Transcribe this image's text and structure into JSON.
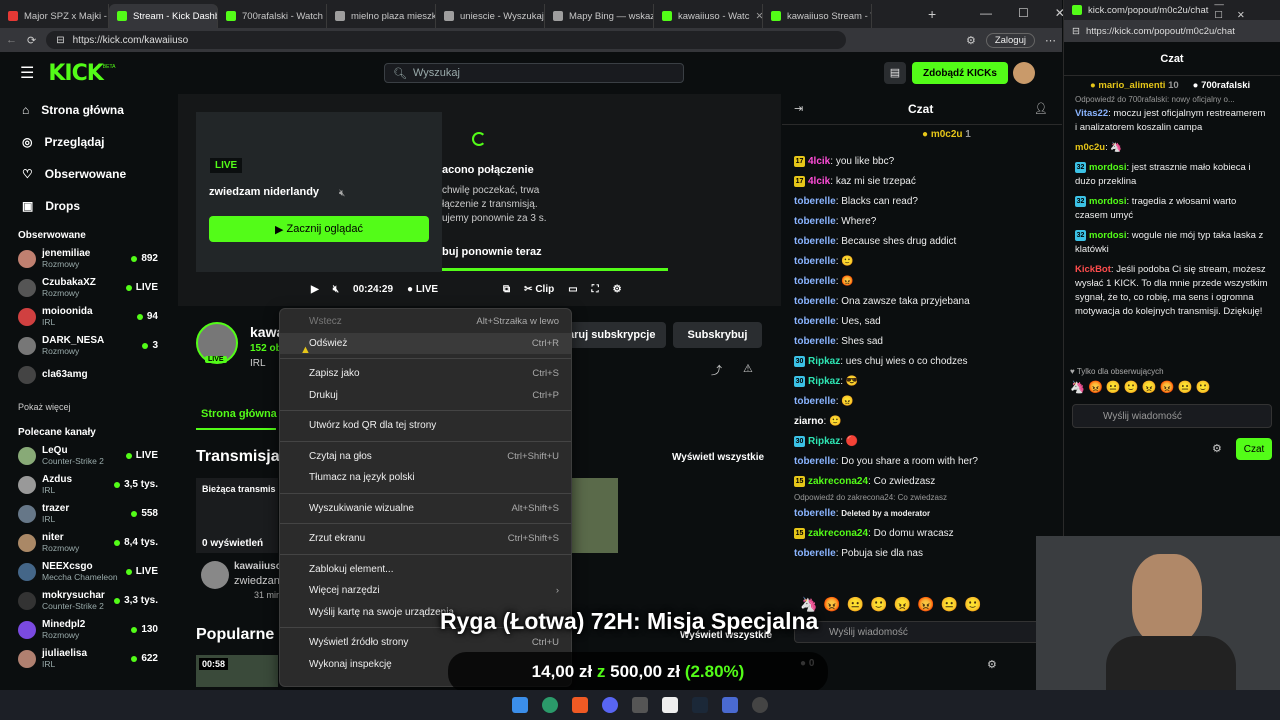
{
  "browser": {
    "tabs": [
      {
        "label": "Major SPZ x Majki -",
        "color": "#e53935"
      },
      {
        "label": "Stream - Kick Dashb",
        "color": "#53fc18",
        "active": true
      },
      {
        "label": "700rafalski - Watch",
        "color": "#53fc18"
      },
      {
        "label": "mielno plaza mieszk",
        "color": "#9e9e9e"
      },
      {
        "label": "uniescie - Wyszukaj",
        "color": "#9e9e9e"
      },
      {
        "label": "Mapy Bing — wskaz",
        "color": "#9e9e9e"
      },
      {
        "label": "kawaiiuso - Watc",
        "color": "#53fc18"
      },
      {
        "label": "kawaiiuso Stream - V",
        "color": "#53fc18"
      }
    ],
    "url": "https://kick.com/kawaiiuso",
    "login": "Zaloguj"
  },
  "header": {
    "logo": "KICK",
    "logo_sup": "BETA",
    "search_placeholder": "Wyszukaj",
    "kicks_button": "Zdobądź KICKs"
  },
  "sidebar": {
    "nav": [
      {
        "label": "Strona główna",
        "icon": "home-icon"
      },
      {
        "label": "Przeglądaj",
        "icon": "compass-icon"
      },
      {
        "label": "Obserwowane",
        "icon": "heart-icon"
      },
      {
        "label": "Drops",
        "icon": "gift-icon"
      }
    ],
    "followed_title": "Obserwowane",
    "followed": [
      {
        "name": "jenemiliae",
        "cat": "Rozmowy",
        "count": "892",
        "color": "#c08070"
      },
      {
        "name": "CzubakaXZ",
        "cat": "Rozmowy",
        "count": "LIVE",
        "color": "#555"
      },
      {
        "name": "moioonida",
        "cat": "IRL",
        "count": "94",
        "color": "#d04040"
      },
      {
        "name": "DARK_NESA",
        "cat": "Rozmowy",
        "count": "3",
        "color": "#777"
      },
      {
        "name": "cla63amg",
        "cat": "",
        "count": "",
        "color": "#444"
      }
    ],
    "show_more": "Pokaż więcej",
    "recommended_title": "Polecane kanały",
    "recommended": [
      {
        "name": "LeQu",
        "cat": "Counter-Strike 2",
        "count": "LIVE",
        "color": "#8a7"
      },
      {
        "name": "Azdus",
        "cat": "IRL",
        "count": "3,5 tys.",
        "color": "#999"
      },
      {
        "name": "trazer",
        "cat": "IRL",
        "count": "558",
        "color": "#678"
      },
      {
        "name": "niter",
        "cat": "Rozmowy",
        "count": "8,4 tys.",
        "color": "#a86"
      },
      {
        "name": "NEEXcsgo",
        "cat": "Meccha Chameleon",
        "count": "LIVE",
        "color": "#468"
      },
      {
        "name": "mokrysuchar",
        "cat": "Counter-Strike 2",
        "count": "3,3 tys.",
        "color": "#333"
      },
      {
        "name": "Minedpl2",
        "cat": "Rozmowy",
        "count": "130",
        "color": "#7a4ae0"
      },
      {
        "name": "jiuliaelisa",
        "cat": "IRL",
        "count": "622",
        "color": "#b08070"
      }
    ]
  },
  "player": {
    "live": "LIVE",
    "title": "zwiedzam niderlandy",
    "watch": "Zacznij oglądać",
    "error_title": "acono połączenie",
    "error_text": "chwilę poczekać, trwa\nłączenie z transmisją.\nujemy ponownie za 3 s.",
    "retry": "buj ponownie teraz",
    "time": "00:24:29",
    "live_ctrl": "LIVE",
    "clip": "Clip"
  },
  "channel": {
    "name": "kawa",
    "followers": "152 ob",
    "tag": "IRL",
    "subscribe_gift": "aruj subskrypcje",
    "subscribe": "Subskrybuj",
    "tab_home": "Strona główna",
    "streams_heading": "Transmisja",
    "view_all": "Wyświetl wszystkie",
    "current": "Bieżąca transmis",
    "views": "0 wyświetleń",
    "vid_channel": "kawaiiuso",
    "vid_title": "zwiedzan",
    "vid_time": "31 min",
    "popular": "Popularne",
    "popular_view_all": "Wyświetl wszystkie",
    "dur": "00:58"
  },
  "context_menu": [
    {
      "label": "Wstecz",
      "shortcut": "Alt+Strzałka w lewo",
      "disabled": true
    },
    {
      "label": "Odśwież",
      "shortcut": "Ctrl+R",
      "hover": true
    },
    {
      "sep": true
    },
    {
      "label": "Zapisz jako",
      "shortcut": "Ctrl+S"
    },
    {
      "label": "Drukuj",
      "shortcut": "Ctrl+P"
    },
    {
      "sep": true
    },
    {
      "label": "Utwórz kod QR dla tej strony",
      "shortcut": ""
    },
    {
      "sep": true
    },
    {
      "label": "Czytaj na głos",
      "shortcut": "Ctrl+Shift+U"
    },
    {
      "label": "Tłumacz na język polski",
      "shortcut": ""
    },
    {
      "sep": true
    },
    {
      "label": "Wyszukiwanie wizualne",
      "shortcut": "Alt+Shift+S"
    },
    {
      "sep": true
    },
    {
      "label": "Zrzut ekranu",
      "shortcut": "Ctrl+Shift+S"
    },
    {
      "sep": true
    },
    {
      "label": "Zablokuj element...",
      "shortcut": ""
    },
    {
      "label": "Więcej narzędzi",
      "shortcut": "›"
    },
    {
      "label": "Wyślij kartę na swoje urządzenia",
      "shortcut": ""
    },
    {
      "sep": true
    },
    {
      "label": "Wyświetl źródło strony",
      "shortcut": "Ctrl+U"
    },
    {
      "label": "Wykonaj inspekcję",
      "shortcut": ""
    }
  ],
  "chat": {
    "title": "Czat",
    "pinned": "m0c2u",
    "pinned_count": "1",
    "messages": [
      {
        "b": "17",
        "bc": "#e6c619",
        "u": "4lcik",
        "uc": "#ff4dd8",
        "t": "you like bbc?"
      },
      {
        "b": "17",
        "bc": "#e6c619",
        "u": "4lcik",
        "uc": "#ff4dd8",
        "t": "kaz mi sie trzepać"
      },
      {
        "u": "toberelle",
        "uc": "#8ab4ff",
        "t": "Blacks can read?"
      },
      {
        "u": "toberelle",
        "uc": "#8ab4ff",
        "t": "Where?"
      },
      {
        "u": "toberelle",
        "uc": "#8ab4ff",
        "t": "Because shes drug addict"
      },
      {
        "u": "toberelle",
        "uc": "#8ab4ff",
        "t": "🙂"
      },
      {
        "u": "toberelle",
        "uc": "#8ab4ff",
        "t": "😡"
      },
      {
        "u": "toberelle",
        "uc": "#8ab4ff",
        "t": "Ona zawsze taka przyjebana"
      },
      {
        "u": "toberelle",
        "uc": "#8ab4ff",
        "t": "Ues, sad"
      },
      {
        "u": "toberelle",
        "uc": "#8ab4ff",
        "t": "Shes sad"
      },
      {
        "b": "30",
        "bc": "#3cc2e6",
        "u": "Ripkaz",
        "uc": "#2ee6b4",
        "t": "ues chuj wies o co chodzes"
      },
      {
        "b": "30",
        "bc": "#3cc2e6",
        "u": "Ripkaz",
        "uc": "#2ee6b4",
        "t": "😎"
      },
      {
        "u": "toberelle",
        "uc": "#8ab4ff",
        "t": "😠"
      },
      {
        "u": "ziarno",
        "uc": "#ffffff",
        "t": "🙂"
      },
      {
        "b": "30",
        "bc": "#3cc2e6",
        "u": "Ripkaz",
        "uc": "#2ee6b4",
        "t": "🔴"
      },
      {
        "u": "toberelle",
        "uc": "#8ab4ff",
        "t": "Do you share a room with her?"
      },
      {
        "b": "15",
        "bc": "#e6c619",
        "u": "zakrecona24",
        "uc": "#53fc18",
        "t": "Co zwiedzasz"
      },
      {
        "reply": "Odpowiedź do zakrecona24: Co zwiedzasz"
      },
      {
        "u": "toberelle",
        "uc": "#8ab4ff",
        "t": "Deleted by a moderator",
        "del": true
      },
      {
        "b": "15",
        "bc": "#e6c619",
        "u": "zakrecona24",
        "uc": "#53fc18",
        "t": "Do domu wracasz"
      },
      {
        "u": "toberelle",
        "uc": "#8ab4ff",
        "t": "Pobuja sie dla nas"
      }
    ],
    "send_placeholder": "Wyślij wiadomość",
    "kicks": "0"
  },
  "popout": {
    "url": "kick.com/popout/m0c2u/chat",
    "url_full": "https://kick.com/popout/m0c2u/chat",
    "title": "Czat",
    "top1": "mario_alimenti",
    "top1_n": "10",
    "top2": "700rafalski",
    "reply": "Odpowiedź do 700rafalski: nowy oficjalny o...",
    "messages": [
      {
        "u": "Vitas22",
        "uc": "#8ab4ff",
        "t": "moczu jest oficjalnym restreamerem i analizatorem koszalin campa"
      },
      {
        "u": "m0c2u",
        "uc": "#e6c619",
        "t": "🦄"
      },
      {
        "b": "32",
        "bc": "#3cc2e6",
        "u": "mordosi",
        "uc": "#53fc18",
        "t": "jest strasznie mało kobieca i dużo przeklina"
      },
      {
        "b": "32",
        "bc": "#3cc2e6",
        "u": "mordosi",
        "uc": "#53fc18",
        "t": "tragedia z włosami warto czasem umyć"
      },
      {
        "b": "32",
        "bc": "#3cc2e6",
        "u": "mordosi",
        "uc": "#53fc18",
        "t": "wogule nie mój typ taka laska z klatówki"
      },
      {
        "u": "KickBot",
        "uc": "#ff4d4d",
        "t": "Jeśli podoba Ci się stream, możesz wysłać 1 KICK. To dla mnie przede wszystkim sygnał, że to, co robię, ma sens i ogromna motywacja do kolejnych transmisji. Dziękuję!"
      }
    ],
    "followers_only": "Tylko dla obserwujących",
    "send_placeholder": "Wyślij wiadomość",
    "chat_btn": "Czat"
  },
  "overlay": {
    "title": "Ryga (Łotwa) 72H: Misja Specjalna",
    "goal_now": "14,00 zł",
    "goal_z": "z",
    "goal_total": "500,00 zł",
    "goal_pct": "(2.80%)"
  }
}
